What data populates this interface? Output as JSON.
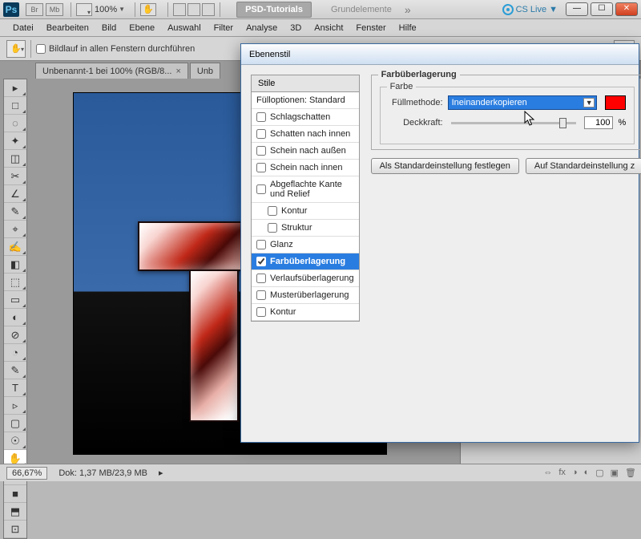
{
  "titlebar": {
    "ps": "Ps",
    "br": "Br",
    "mb": "Mb",
    "zoom": "100%",
    "workspace_active": "PSD-Tutorials",
    "workspace_inactive": "Grundelemente",
    "cslive": "CS Live"
  },
  "menu": [
    "Datei",
    "Bearbeiten",
    "Bild",
    "Ebene",
    "Auswahl",
    "Filter",
    "Analyse",
    "3D",
    "Ansicht",
    "Fenster",
    "Hilfe"
  ],
  "optbar": {
    "scroll_all": "Bildlauf in allen Fenstern durchführen"
  },
  "tabs": [
    {
      "label": "Unbenannt-1 bei 100% (RGB/8...",
      "closable": true
    },
    {
      "label": "Unb",
      "closable": false
    }
  ],
  "status": {
    "zoom": "66,67%",
    "doc": "Dok: 1,37 MB/23,9 MB"
  },
  "dialog": {
    "title": "Ebenenstil",
    "styles_head": "Stile",
    "fill_opts": "Fülloptionen: Standard",
    "effects": [
      {
        "label": "Schlagschatten",
        "checked": false
      },
      {
        "label": "Schatten nach innen",
        "checked": false
      },
      {
        "label": "Schein nach außen",
        "checked": false
      },
      {
        "label": "Schein nach innen",
        "checked": false
      },
      {
        "label": "Abgeflachte Kante und Relief",
        "checked": false
      },
      {
        "label": "Kontur",
        "checked": false,
        "sub": true
      },
      {
        "label": "Struktur",
        "checked": false,
        "sub": true
      },
      {
        "label": "Glanz",
        "checked": false
      },
      {
        "label": "Farbüberlagerung",
        "checked": true,
        "selected": true
      },
      {
        "label": "Verlaufsüberlagerung",
        "checked": false
      },
      {
        "label": "Musterüberlagerung",
        "checked": false
      },
      {
        "label": "Kontur",
        "checked": false
      }
    ],
    "panel_title": "Farbüberlagerung",
    "color_title": "Farbe",
    "blend_label": "Füllmethode:",
    "blend_value": "Ineinanderkopieren",
    "opacity_label": "Deckkraft:",
    "opacity_value": "100",
    "opacity_unit": "%",
    "btn_default": "Als Standardeinstellung festlegen",
    "btn_reset": "Auf Standardeinstellung z"
  },
  "tool_icons": [
    "▸",
    "□",
    "◌",
    "✦",
    "◫",
    "✂",
    "∠",
    "✎",
    "⌖",
    "✍",
    "◧",
    "⬚",
    "▭",
    "◐",
    "⊘",
    "◔",
    "✎",
    "T",
    "▹",
    "▢",
    "☉",
    "✋",
    "⤢",
    "■",
    "⬒",
    "⊡"
  ]
}
